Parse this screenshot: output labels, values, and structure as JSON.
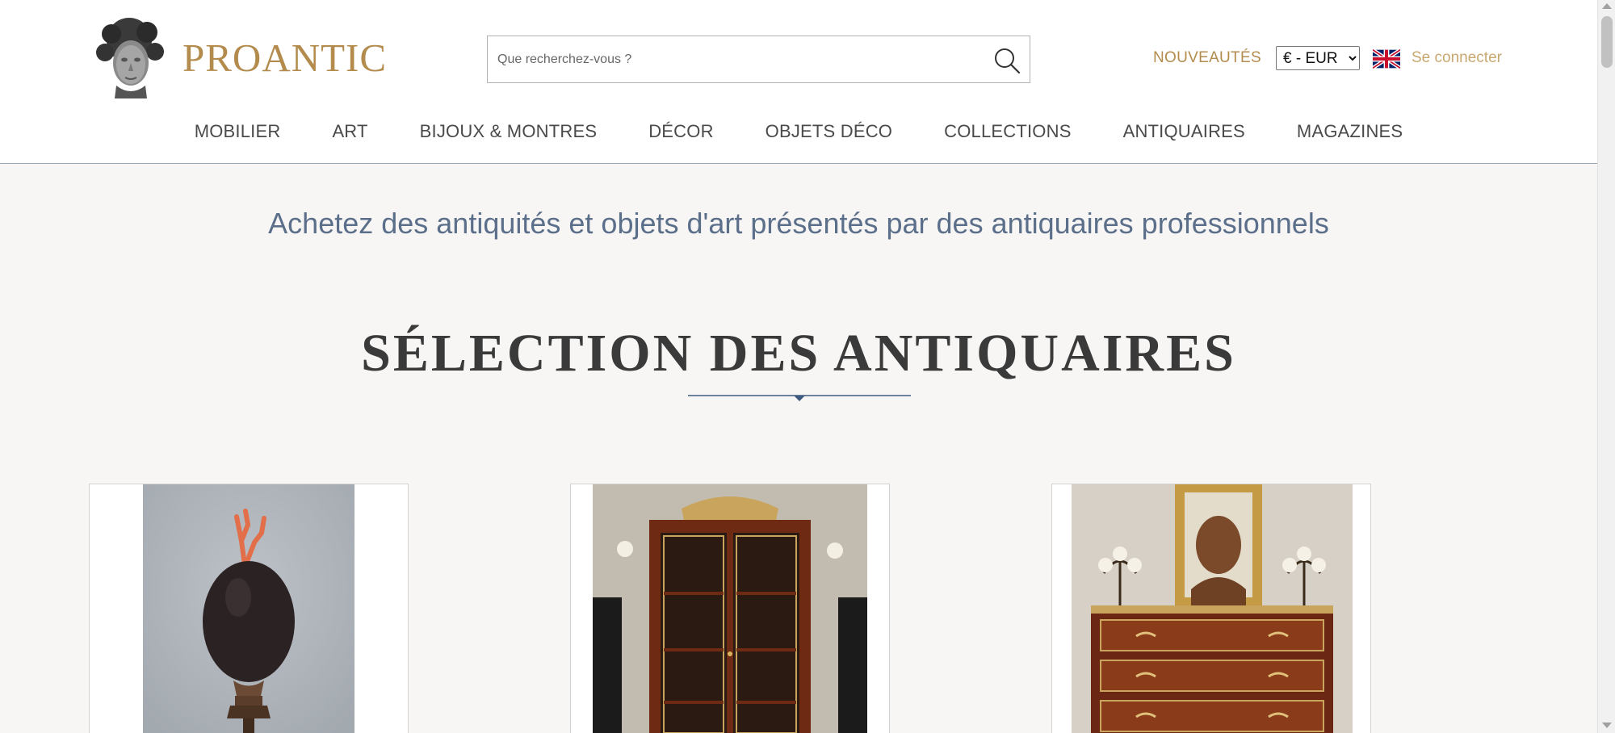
{
  "header": {
    "logo_text": "PROANTIC",
    "search": {
      "placeholder": "Que recherchez-vous ?",
      "value": ""
    },
    "nouveautes_label": "NOUVEAUTÉS",
    "currency": {
      "selected": "€ - EUR"
    },
    "language_flag": "uk-flag-icon",
    "login_label": "Se connecter"
  },
  "nav": {
    "items": [
      {
        "label": "MOBILIER"
      },
      {
        "label": "ART"
      },
      {
        "label": "BIJOUX & MONTRES"
      },
      {
        "label": "DÉCOR"
      },
      {
        "label": "OBJETS DÉCO"
      },
      {
        "label": "COLLECTIONS"
      },
      {
        "label": "ANTIQUAIRES"
      },
      {
        "label": "MAGAZINES"
      }
    ]
  },
  "main": {
    "tagline": "Achetez des antiquités et objets d'art présentés par des antiquaires professionnels",
    "section_title": "SÉLECTION DES ANTIQUAIRES",
    "products": [
      {
        "image": "egg-with-coral-sculpture"
      },
      {
        "image": "mahogany-bookcase-cabinet"
      },
      {
        "image": "mahogany-commode-with-mirror"
      }
    ]
  },
  "colors": {
    "brand_gold": "#b38c4d",
    "tagline_blue": "#5b6f8a",
    "background": "#f7f6f4"
  }
}
